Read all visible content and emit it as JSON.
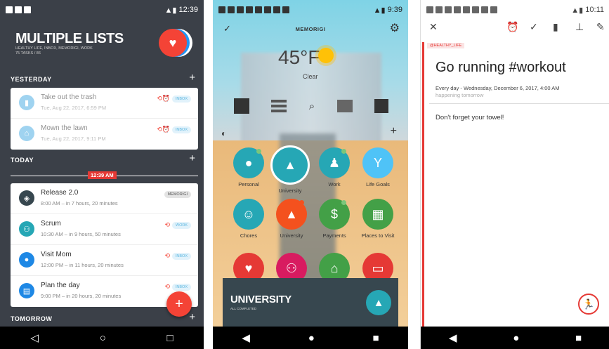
{
  "phone1": {
    "status_time": "12:39",
    "title": "MULTIPLE LISTS",
    "subtitle_lists": "HEALTHY LIFE, INBOX, MEMORIGI, WORK",
    "subtitle_tasks": "75 TASKS / 86",
    "sections": {
      "yesterday": "YESTERDAY",
      "today": "TODAY",
      "tomorrow": "TOMORROW"
    },
    "current_time_badge": "12:39 AM",
    "yesterday_tasks": [
      {
        "title": "Take out the trash",
        "time": "Tue, Aug 22, 2017, 6:59 PM",
        "tag": "INBOX"
      },
      {
        "title": "Mown the lawn",
        "time": "Tue, Aug 22, 2017, 9:11 PM",
        "tag": "INBOX"
      }
    ],
    "today_tasks": [
      {
        "title": "Release 2.0",
        "time": "8:00 AM – in 7 hours, 20 minutes",
        "tag": "MEMORIGI"
      },
      {
        "title": "Scrum",
        "time": "10:30 AM – in 9 hours, 50 minutes",
        "tag": "WORK"
      },
      {
        "title": "Visit Mom",
        "time": "12:00 PM – in 11 hours, 20 minutes",
        "tag": "INBOX"
      },
      {
        "title": "Plan the day",
        "time": "9:00 PM – in 20 hours, 20 minutes",
        "tag": "INBOX"
      }
    ],
    "fab_label": "+"
  },
  "phone2": {
    "status_time": "9:39",
    "title": "MEMORIGI",
    "temperature": "45°F",
    "condition": "Clear",
    "lists": [
      {
        "label": "Personal",
        "color": "#26a7b5"
      },
      {
        "label": "University",
        "color": "#26a7b5"
      },
      {
        "label": "Work",
        "color": "#26a7b5"
      },
      {
        "label": "Life Goals",
        "color": "#4fc3f7"
      },
      {
        "label": "Chores",
        "color": "#26a7b5"
      },
      {
        "label": "University",
        "color": "#f4511e"
      },
      {
        "label": "Payments",
        "color": "#43a047"
      },
      {
        "label": "Places to Visit",
        "color": "#43a047"
      },
      {
        "label": "",
        "color": "#e53935"
      },
      {
        "label": "",
        "color": "#d81b60"
      },
      {
        "label": "",
        "color": "#43a047"
      },
      {
        "label": "",
        "color": "#e53935"
      }
    ],
    "panel_title": "UNIVERSITY",
    "panel_subtitle": "ALL COMPLETED"
  },
  "phone3": {
    "status_time": "10:11",
    "tag": "@HEALTHY_LIFE",
    "title": "Go running #workout",
    "recurrence": "Every day - Wednesday, December 6, 2017, 4:00 AM",
    "relative": "happening tomorrow",
    "note": "Don't forget your towel!"
  }
}
